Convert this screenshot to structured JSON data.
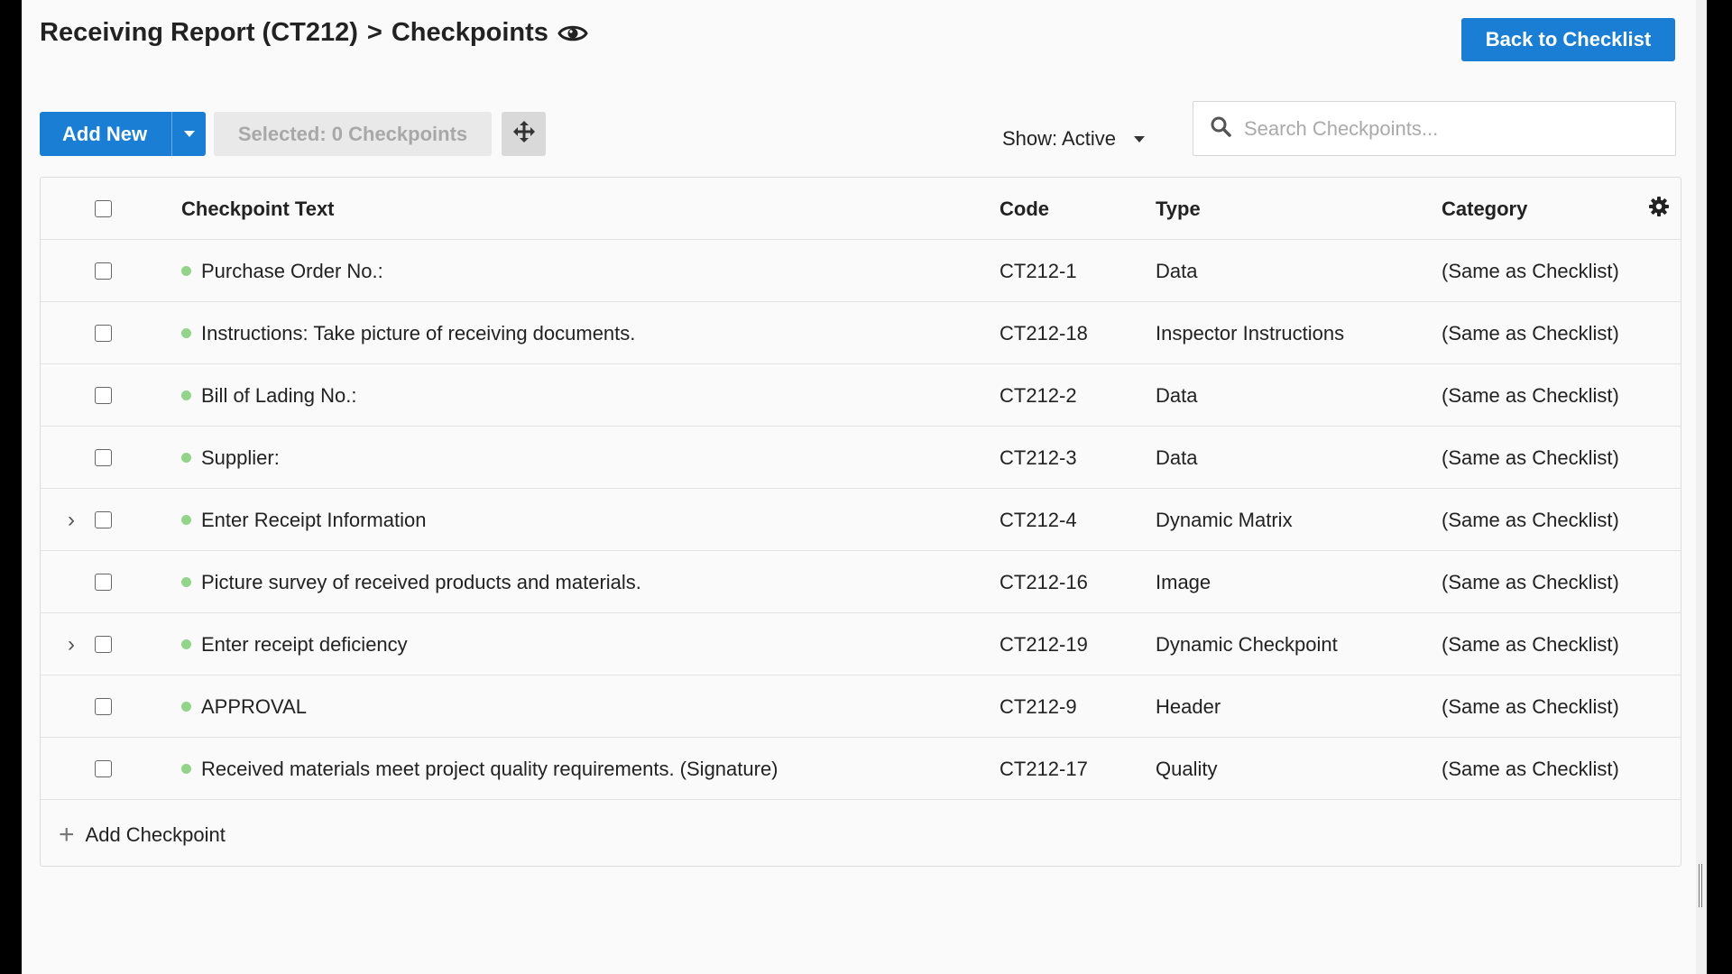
{
  "page": {
    "breadcrumb_parent": "Receiving Report (CT212)",
    "breadcrumb_sep": ">",
    "breadcrumb_current": "Checkpoints",
    "back_button": "Back to Checklist"
  },
  "toolbar": {
    "add_new": "Add New",
    "selected_label": "Selected: 0 Checkpoints",
    "show_filter": "Show: Active",
    "search_placeholder": "Search Checkpoints..."
  },
  "table": {
    "columns": [
      "Checkpoint Text",
      "Code",
      "Type",
      "Category"
    ],
    "rows": [
      {
        "text": "Purchase Order No.:",
        "code": "CT212-1",
        "type": "Data",
        "category": "(Same as Checklist)",
        "expandable": false
      },
      {
        "text": "Instructions: Take picture of receiving documents.",
        "code": "CT212-18",
        "type": "Inspector Instructions",
        "category": "(Same as Checklist)",
        "expandable": false
      },
      {
        "text": "Bill of Lading No.:",
        "code": "CT212-2",
        "type": "Data",
        "category": "(Same as Checklist)",
        "expandable": false
      },
      {
        "text": "Supplier:",
        "code": "CT212-3",
        "type": "Data",
        "category": "(Same as Checklist)",
        "expandable": false
      },
      {
        "text": "Enter Receipt Information",
        "code": "CT212-4",
        "type": "Dynamic Matrix",
        "category": "(Same as Checklist)",
        "expandable": true
      },
      {
        "text": "Picture survey of received products and materials.",
        "code": "CT212-16",
        "type": "Image",
        "category": "(Same as Checklist)",
        "expandable": false
      },
      {
        "text": "Enter receipt deficiency",
        "code": "CT212-19",
        "type": "Dynamic Checkpoint",
        "category": "(Same as Checklist)",
        "expandable": true
      },
      {
        "text": "APPROVAL",
        "code": "CT212-9",
        "type": "Header",
        "category": "(Same as Checklist)",
        "expandable": false
      },
      {
        "text": "Received materials meet project quality requirements. (Signature)",
        "code": "CT212-17",
        "type": "Quality",
        "category": "(Same as Checklist)",
        "expandable": false
      }
    ],
    "add_checkpoint": "Add Checkpoint"
  },
  "colors": {
    "primary": "#1a7fd4",
    "status_active": "#92d48a"
  },
  "icons": {
    "view": "eye-icon",
    "move": "move-arrows-icon",
    "search": "search-icon",
    "settings": "gear-icon",
    "expand": "chevron-right-icon",
    "add": "plus-icon"
  }
}
